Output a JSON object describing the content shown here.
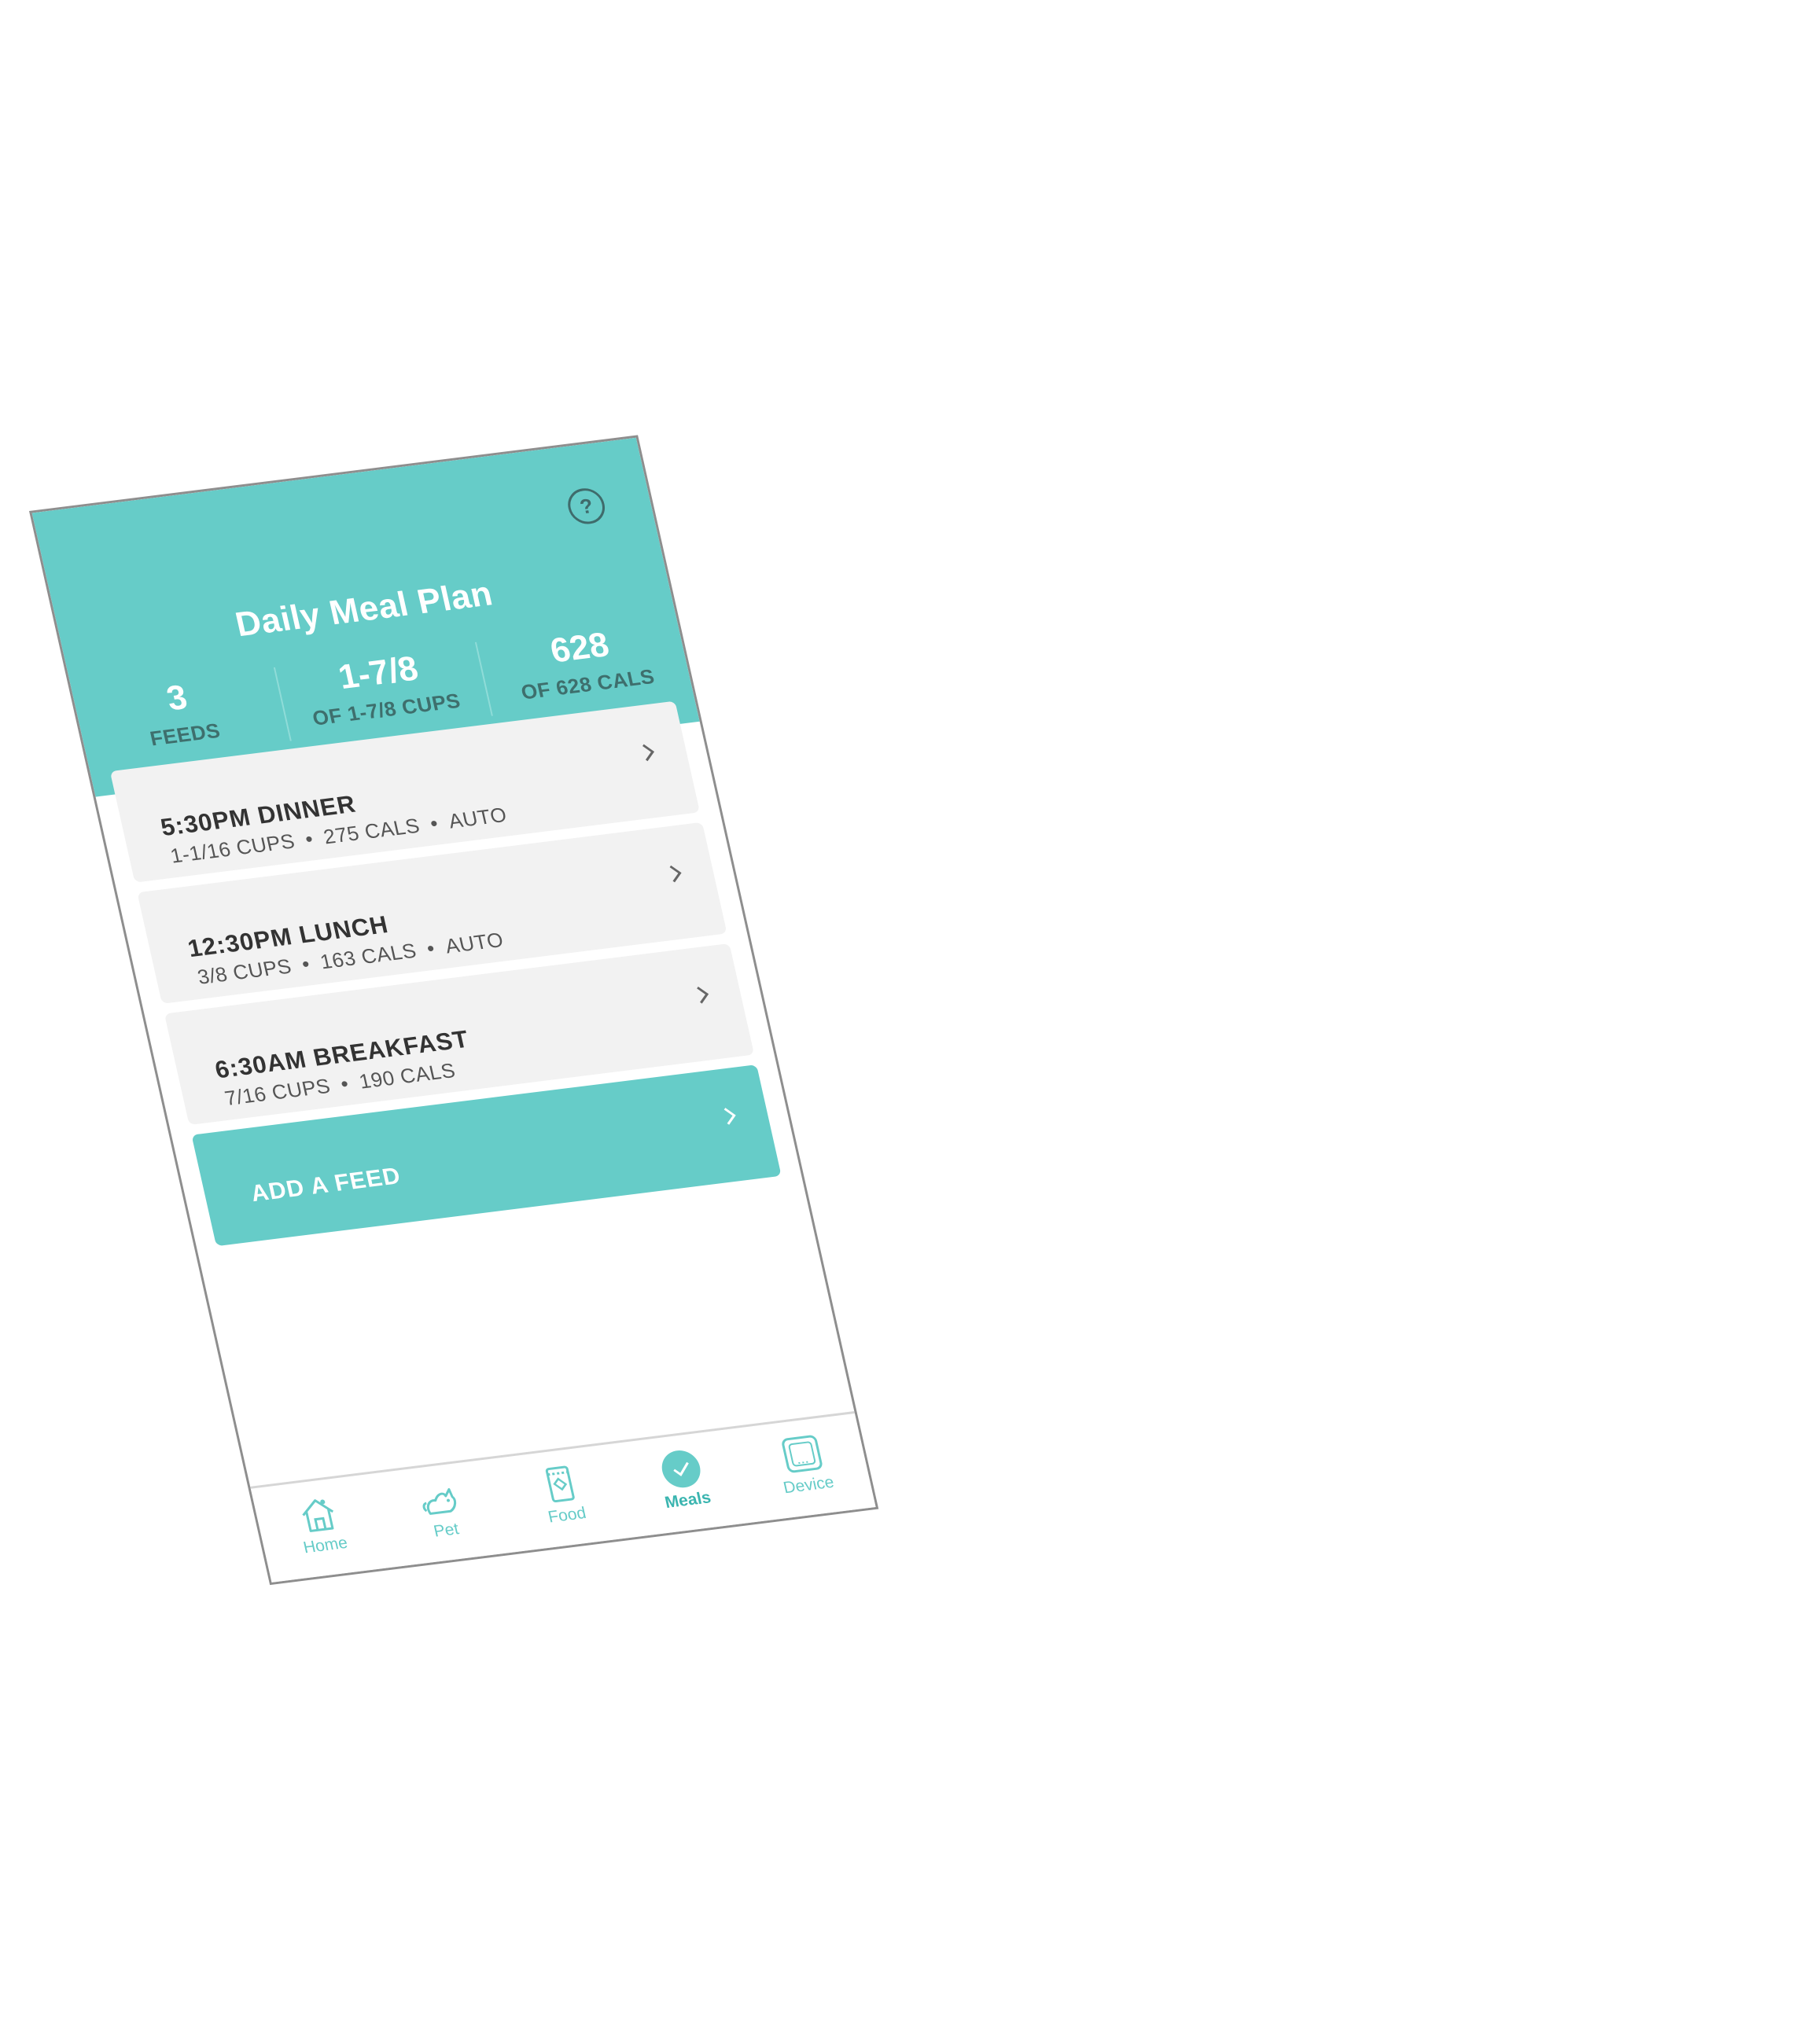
{
  "header": {
    "title": "Daily Meal Plan",
    "help_icon": "?",
    "stats": [
      {
        "value": "3",
        "label": "FEEDS"
      },
      {
        "value": "1-7/8",
        "label": "OF 1-7/8 CUPS"
      },
      {
        "value": "628",
        "label": "OF 628 CALS"
      }
    ]
  },
  "meals": [
    {
      "title": "5:30PM DINNER",
      "cups": "1-1/16 CUPS",
      "cals": "275 CALS",
      "mode": "AUTO"
    },
    {
      "title": "12:30PM LUNCH",
      "cups": "3/8 CUPS",
      "cals": "163 CALS",
      "mode": "AUTO"
    },
    {
      "title": "6:30AM BREAKFAST",
      "cups": "7/16 CUPS",
      "cals": "190 CALS",
      "mode": ""
    }
  ],
  "add_feed": {
    "label": "ADD A FEED"
  },
  "tabs": [
    {
      "label": "Home",
      "icon": "home-icon"
    },
    {
      "label": "Pet",
      "icon": "pet-icon"
    },
    {
      "label": "Food",
      "icon": "food-bag-icon"
    },
    {
      "label": "Meals",
      "icon": "check-circle-icon",
      "active": true
    },
    {
      "label": "Device",
      "icon": "device-icon"
    }
  ],
  "colors": {
    "accent": "#66ccc8",
    "card_bg": "#f2f2f2",
    "text_dark": "#333333"
  }
}
